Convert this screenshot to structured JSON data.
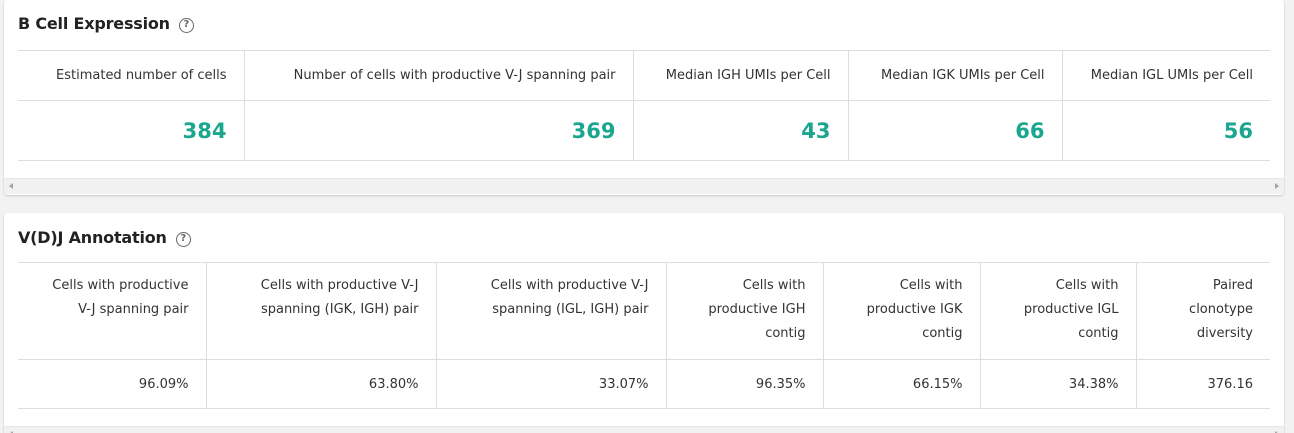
{
  "bcell": {
    "title": "B Cell Expression",
    "help_icon": "?",
    "headers": [
      "Estimated number of cells",
      "Number of cells with productive V-J spanning pair",
      "Median IGH UMIs per Cell",
      "Median IGK UMIs per Cell",
      "Median IGL UMIs per Cell"
    ],
    "values": [
      "384",
      "369",
      "43",
      "66",
      "56"
    ]
  },
  "vdj": {
    "title": "V(D)J Annotation",
    "help_icon": "?",
    "headers": [
      [
        "Cells with productive",
        "V-J spanning pair"
      ],
      [
        "Cells with productive V-J",
        "spanning (IGK, IGH) pair"
      ],
      [
        "Cells with productive V-J",
        "spanning (IGL, IGH) pair"
      ],
      [
        "Cells with",
        "productive IGH",
        "contig"
      ],
      [
        "Cells with",
        "productive IGK",
        "contig"
      ],
      [
        "Cells with",
        "productive IGL",
        "contig"
      ],
      [
        "Paired",
        "clonotype",
        "diversity"
      ]
    ],
    "values": [
      "96.09%",
      "63.80%",
      "33.07%",
      "96.35%",
      "66.15%",
      "34.38%",
      "376.16"
    ]
  },
  "colors": {
    "accent_value": "#1aa68f",
    "border": "#dddddd",
    "background": "#f2f2f2"
  }
}
